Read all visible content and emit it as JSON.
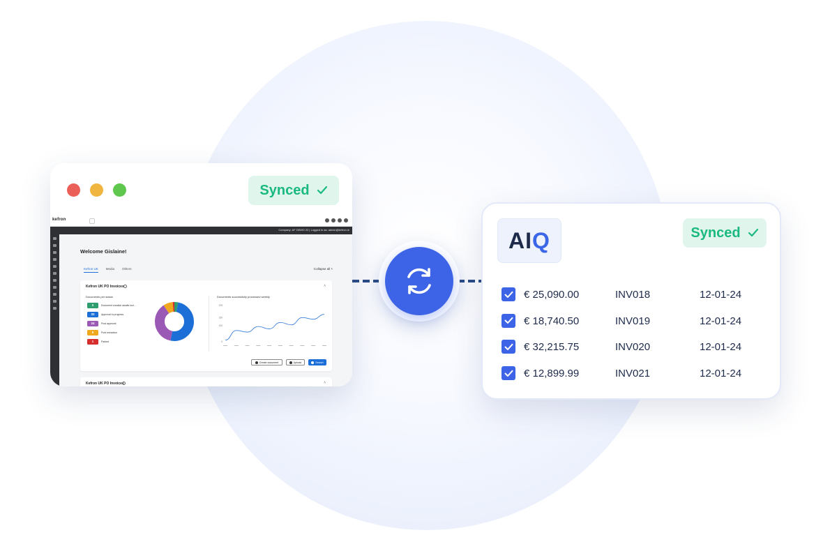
{
  "left_window": {
    "synced_label": "Synced",
    "app": {
      "brand": "kefron",
      "company_info": "Company: AF DEMO 22 | Logged in as: admin@kefron.ie",
      "welcome": "Welcome Gislaine!",
      "tabs": [
        "Kefron UK",
        "Media",
        "Others"
      ],
      "collapse_all": "Collapse all",
      "card1": {
        "title": "Kefron UK PO Invoices",
        "status_section_title": "Documents per status",
        "statuses": [
          {
            "count": "2",
            "label": "Document creation awaits tool...",
            "color": "#2f9e6e"
          },
          {
            "count": "32",
            "label": "Approval in progress",
            "color": "#1d6fd8"
          },
          {
            "count": "24",
            "label": "Post approval",
            "color": "#9b59b6"
          },
          {
            "count": "5",
            "label": "Post extraction",
            "color": "#f0a91e"
          },
          {
            "count": "1",
            "label": "Parked",
            "color": "#d62d2d"
          }
        ],
        "weekly_title": "Documents successfully processed weekly",
        "buttons": {
          "create": "Create document",
          "upload": "Upload",
          "search": "Search"
        }
      },
      "card2": {
        "title": "Kefron UK PO Invoices"
      }
    }
  },
  "chart_data": [
    {
      "type": "pie",
      "title": "Documents per status",
      "categories": [
        "Document creation awaits tool...",
        "Approval in progress",
        "Post approval",
        "Post extraction",
        "Parked"
      ],
      "values": [
        2,
        32,
        24,
        5,
        1
      ]
    },
    {
      "type": "line",
      "title": "Documents successfully processed weekly",
      "x": [
        "",
        "",
        "",
        "",
        "",
        "",
        "",
        "",
        "",
        ""
      ],
      "values": [
        10,
        70,
        60,
        95,
        80,
        120,
        105,
        150,
        140,
        170
      ],
      "ylim": [
        0,
        225
      ],
      "yticks": [
        "225",
        "150",
        "100",
        "0"
      ]
    }
  ],
  "connector": {
    "icon": "sync-icon"
  },
  "right_card": {
    "logo": {
      "a": "A",
      "i": "I",
      "q": "Q"
    },
    "synced_label": "Synced",
    "rows": [
      {
        "amount": "€ 25,090.00",
        "invoice": "INV018",
        "date": "12-01-24",
        "checked": true
      },
      {
        "amount": "€ 18,740.50",
        "invoice": "INV019",
        "date": "12-01-24",
        "checked": true
      },
      {
        "amount": "€ 32,215.75",
        "invoice": "INV020",
        "date": "12-01-24",
        "checked": true
      },
      {
        "amount": "€ 12,899.99",
        "invoice": "INV021",
        "date": "12-01-24",
        "checked": true
      }
    ]
  },
  "colors": {
    "accent": "#3d64e6",
    "synced_text": "#19b97f",
    "synced_bg": "#e0f6ec"
  }
}
